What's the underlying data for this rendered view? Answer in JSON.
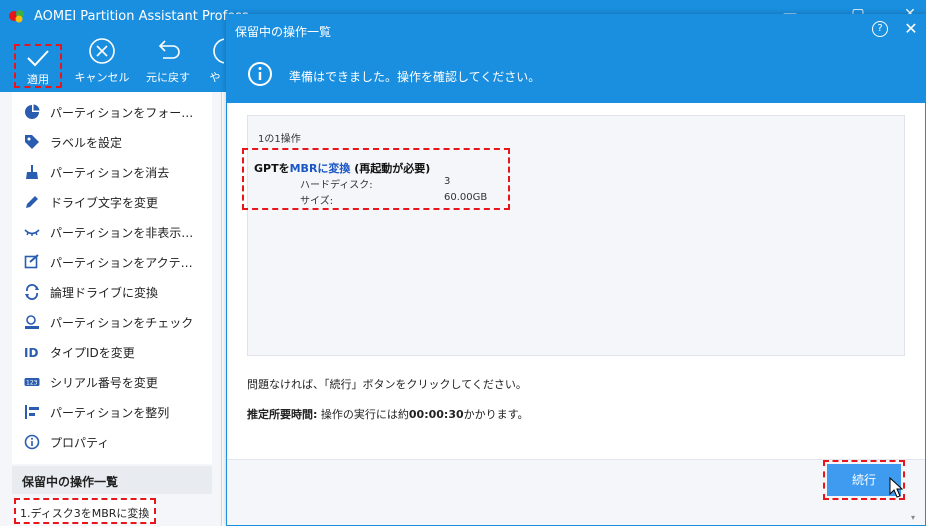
{
  "app": {
    "title": "AOMEI Partition Assistant Profess"
  },
  "toolbar": {
    "apply_label": "適用",
    "cancel_label": "キャンセル",
    "undo_label": "元に戻す",
    "partial_label": "や"
  },
  "sidebar": {
    "items": [
      {
        "label": "パーティションをフォー…",
        "icon": "pie-chart-icon"
      },
      {
        "label": "ラベルを設定",
        "icon": "tag-icon"
      },
      {
        "label": "パーティションを消去",
        "icon": "broom-icon"
      },
      {
        "label": "ドライブ文字を変更",
        "icon": "pencil-icon"
      },
      {
        "label": "パーティションを非表示…",
        "icon": "eye-hidden-icon"
      },
      {
        "label": "パーティションをアクテ…",
        "icon": "check-edit-icon"
      },
      {
        "label": "論理ドライブに変換",
        "icon": "convert-icon"
      },
      {
        "label": "パーティションをチェック",
        "icon": "check-disk-icon"
      },
      {
        "label": "タイプIDを変更",
        "icon": "id-icon"
      },
      {
        "label": "シリアル番号を変更",
        "icon": "serial-icon"
      },
      {
        "label": "パーティションを整列",
        "icon": "align-icon"
      },
      {
        "label": "プロパティ",
        "icon": "info-icon"
      }
    ],
    "pending_header": "保留中の操作一覧",
    "pending_item": "1.ディスク3をMBRに変換"
  },
  "dialog": {
    "title": "保留中の操作一覧",
    "help": "?",
    "info_text": "準備はできました。操作を確認してください。",
    "ops_count": "1の1操作",
    "op_title_prefix": "GPTを",
    "op_title_accent": "MBRに変換",
    "op_title_suffix": " (再起動が必要)",
    "op_disk_label": "ハードディスク:",
    "op_disk_value": "3",
    "op_size_label": "サイズ:",
    "op_size_value": "60.00GB",
    "confirm_text": "問題なければ、「続行」ボタンをクリックしてください。",
    "estimate_label": "推定所要時間:",
    "estimate_prefix": "操作の実行には約",
    "estimate_time": "00:00:30",
    "estimate_suffix": "かかります。",
    "continue_label": "続行"
  },
  "colors": {
    "accent": "#1a8fe0",
    "highlight": "#e8151b",
    "button": "#3e9bf0"
  }
}
